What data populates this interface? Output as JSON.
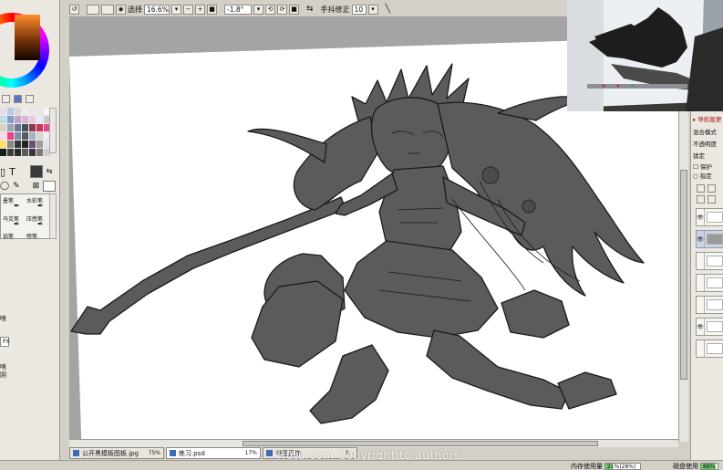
{
  "toolbar": {
    "select_label": "选择",
    "zoom": "16.6%",
    "rotation": "-1.8°",
    "stabilizer_label": "手抖修正",
    "stabilizer_value": "10"
  },
  "tools": {
    "text_tool_glyph": "T"
  },
  "brushes": [
    "墨笔",
    "水彩笔",
    "马克笔",
    "压感笔",
    "铅笔",
    "喷笔"
  ],
  "left_panel_text": {
    "item_a": "啥",
    "item_b": "PX",
    "item_c1": "啥",
    "item_c2": "阴"
  },
  "tabs": [
    {
      "name": "公开黑模板图板.jpg",
      "zoom": "75%"
    },
    {
      "name": "练习.psd",
      "zoom": "17%"
    },
    {
      "name": "书签正作",
      "zoom": "3..."
    }
  ],
  "watermark": "Hutu.com Copyright to authors",
  "status": {
    "memory_label": "内存使用量",
    "memory_value": "21%(28%)",
    "memory_fill": 0.21,
    "disk_label": "磁盘使用",
    "disk_value": "88%",
    "disk_fill": 0.88
  },
  "layer_panel": {
    "title": "▸ 导航版更",
    "blend_mode": "混合模式",
    "opacity": "不透明度",
    "lock": "锁定",
    "option_1": "保护",
    "option_2": "指定"
  },
  "colors": {
    "accent": "#69c769",
    "canvas_bg": "#a4a4a4",
    "silhouette": "#5b5b5b"
  }
}
